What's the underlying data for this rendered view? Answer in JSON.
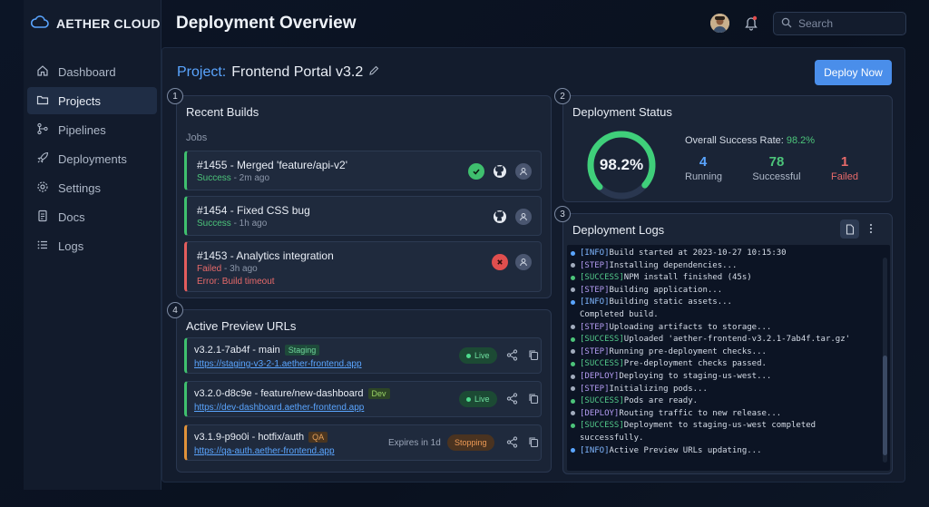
{
  "brand": {
    "name": "AETHER CLOUD"
  },
  "sidebar": {
    "items": [
      {
        "label": "Dashboard",
        "icon": "home-icon"
      },
      {
        "label": "Projects",
        "icon": "folder-icon",
        "active": true
      },
      {
        "label": "Pipelines",
        "icon": "pipeline-icon"
      },
      {
        "label": "Deployments",
        "icon": "rocket-icon"
      },
      {
        "label": "Settings",
        "icon": "gear-icon"
      },
      {
        "label": "Docs",
        "icon": "document-icon"
      },
      {
        "label": "Logs",
        "icon": "list-icon"
      }
    ]
  },
  "header": {
    "title": "Deployment Overview",
    "search_placeholder": "Search"
  },
  "project": {
    "label": "Project:",
    "name": "Frontend Portal v3.2",
    "deploy_label": "Deploy Now"
  },
  "builds": {
    "number": "1",
    "title": "Recent Builds",
    "jobs_label": "Jobs",
    "items": [
      {
        "title": "#1455 - Merged 'feature/api-v2'",
        "status": "Success",
        "time": " - 2m ago",
        "error": ""
      },
      {
        "title": "#1454 - Fixed CSS bug",
        "status": "Success",
        "time": " - 1h ago",
        "error": ""
      },
      {
        "title": "#1453 - Analytics integration",
        "status": "Failed",
        "time": " - 3h ago",
        "error": "Error: Build timeout"
      }
    ]
  },
  "status": {
    "number": "2",
    "title": "Deployment Status",
    "gauge_value": "98.2%",
    "gauge_fraction": 0.982,
    "rate_label": "Overall Success Rate:",
    "rate_value": "98.2%",
    "running": "4",
    "running_label": "Running",
    "successful": "78",
    "successful_label": "Successful",
    "failed": "1",
    "failed_label": "Failed",
    "colors": {
      "running": "#5aa5ff",
      "successful": "#4cc47a",
      "failed": "#e86a6a"
    }
  },
  "urls": {
    "number": "4",
    "title": "Active Preview URLs",
    "items": [
      {
        "version": "v3.2.1-7ab4f - main",
        "env": "Staging",
        "link": "https://staging-v3-2-1.aether-frontend.app",
        "state": "Live",
        "expires": ""
      },
      {
        "version": "v3.2.0-d8c9e - feature/new-dashboard",
        "env": "Dev",
        "link": "https://dev-dashboard.aether-frontend.app",
        "state": "Live",
        "expires": ""
      },
      {
        "version": "v3.1.9-p9o0i - hotfix/auth",
        "env": "QA",
        "link": "https://qa-auth.aether-frontend.app",
        "state": "Stopping",
        "expires": "Expires in 1d"
      }
    ]
  },
  "logs": {
    "number": "3",
    "title": "Deployment Logs",
    "lines": [
      {
        "tag": "[INFO]",
        "text": " Build started at 2023-10-27 10:15:30",
        "kind": "info"
      },
      {
        "tag": "[STEP]",
        "text": " Installing dependencies...",
        "kind": "step"
      },
      {
        "tag": "[SUCCESS]",
        "text": " NPM install finished (45s)",
        "kind": "success"
      },
      {
        "tag": "[STEP]",
        "text": " Building application...",
        "kind": "step"
      },
      {
        "tag": "[INFO]",
        "text": " Building static assets...",
        "kind": "info"
      },
      {
        "tag": "",
        "text": "Completed build.",
        "kind": "cont"
      },
      {
        "tag": "[STEP]",
        "text": " Uploading artifacts to storage...",
        "kind": "step"
      },
      {
        "tag": "[SUCCESS]",
        "text": " Uploaded 'aether-frontend-v3.2.1-7ab4f.tar.gz'",
        "kind": "success"
      },
      {
        "tag": "[STEP]",
        "text": " Running pre-deployment checks...",
        "kind": "step"
      },
      {
        "tag": "[SUCCESS]",
        "text": " Pre-deployment checks passed.",
        "kind": "success"
      },
      {
        "tag": "[DEPLOY]",
        "text": " Deploying to staging-us-west...",
        "kind": "deploy"
      },
      {
        "tag": "[STEP]",
        "text": " Initializing pods...",
        "kind": "step"
      },
      {
        "tag": "[SUCCESS]",
        "text": " Pods are ready.",
        "kind": "success"
      },
      {
        "tag": "[DEPLOY]",
        "text": " Routing traffic to new release...",
        "kind": "deploy"
      },
      {
        "tag": "[SUCCESS]",
        "text": " Deployment to staging-us-west completed",
        "kind": "success"
      },
      {
        "tag": "",
        "text": "successfully.",
        "kind": "cont"
      },
      {
        "tag": "[INFO]",
        "text": " Active Preview URLs updating...",
        "kind": "info"
      }
    ]
  }
}
